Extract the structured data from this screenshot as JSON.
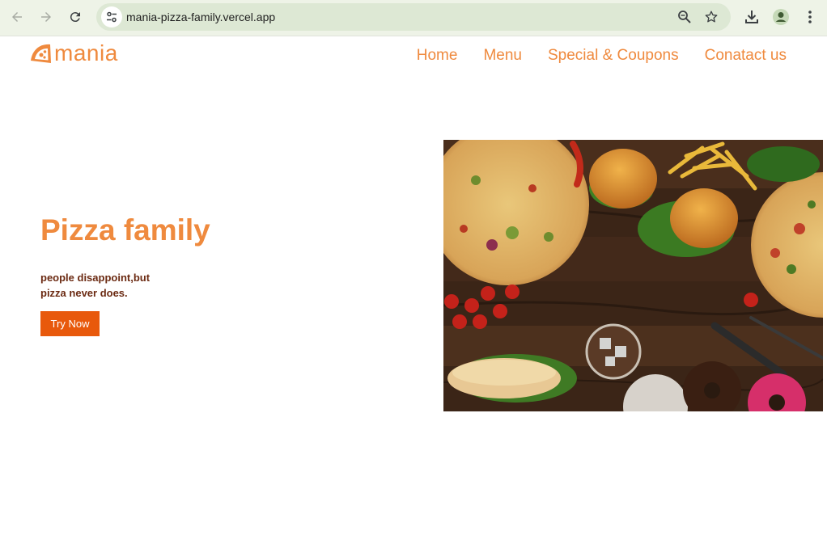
{
  "browser": {
    "url": "mania-pizza-family.vercel.app",
    "icons": {
      "back": "arrow-left-icon",
      "forward": "arrow-right-icon",
      "reload": "reload-icon",
      "site_info": "tune-icon",
      "zoom": "zoom-icon",
      "bookmark": "star-icon",
      "download": "download-icon",
      "profile": "profile-icon",
      "menu": "kebab-menu-icon"
    }
  },
  "site": {
    "brand": "mania",
    "accent_color": "#ef8a3e",
    "nav": [
      {
        "label": "Home"
      },
      {
        "label": "Menu"
      },
      {
        "label": "Special & Coupons"
      },
      {
        "label": "Conatact us"
      }
    ]
  },
  "hero": {
    "title": "Pizza family",
    "tagline_line1": "people disappoint,but",
    "tagline_line2": "pizza never does.",
    "cta_label": "Try Now",
    "cta_color": "#e8590c",
    "image_subject": "pizzas, burgers, fries, drinks and donuts on a wooden table"
  }
}
